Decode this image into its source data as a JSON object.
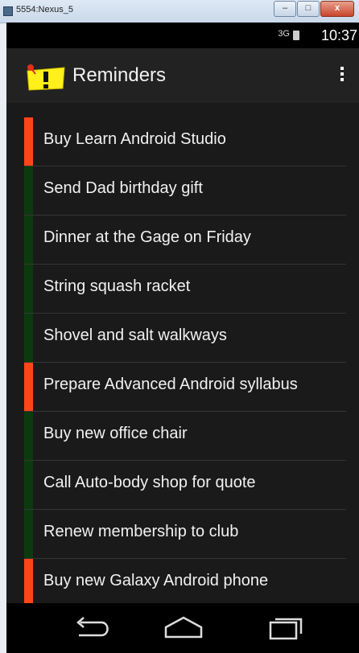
{
  "window": {
    "title": "5554:Nexus_5",
    "minimize": "–",
    "maximize": "□",
    "close": "x"
  },
  "status_bar": {
    "network": "3G",
    "time": "10:37"
  },
  "action_bar": {
    "title": "Reminders",
    "logo_icon": "reminder-note-icon",
    "menu_icon": "overflow-menu-icon"
  },
  "colors": {
    "important": "#ff4619",
    "normal": "#0c3a0e",
    "list_bg": "#1a1a1a",
    "action_bar_bg": "#222222"
  },
  "reminders": [
    {
      "text": "Buy Learn Android Studio",
      "important": true
    },
    {
      "text": "Send Dad birthday gift",
      "important": false
    },
    {
      "text": "Dinner at the Gage on Friday",
      "important": false
    },
    {
      "text": "String squash racket",
      "important": false
    },
    {
      "text": "Shovel and salt walkways",
      "important": false
    },
    {
      "text": "Prepare Advanced Android syllabus",
      "important": true
    },
    {
      "text": "Buy new office chair",
      "important": false
    },
    {
      "text": "Call Auto-body shop for quote",
      "important": false
    },
    {
      "text": "Renew membership to club",
      "important": false
    },
    {
      "text": "Buy new Galaxy Android phone",
      "important": true
    }
  ],
  "nav_bar": {
    "back_icon": "back-icon",
    "home_icon": "home-icon",
    "recents_icon": "recents-icon"
  }
}
